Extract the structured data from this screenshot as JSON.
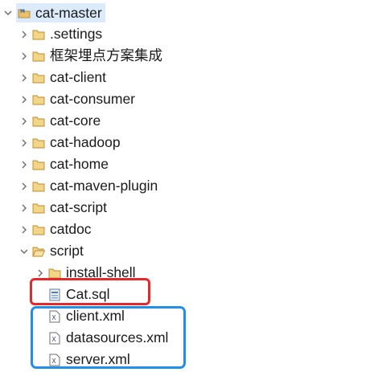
{
  "tree": {
    "root": {
      "label": "cat-master",
      "icon": "maven-project-icon",
      "expanded": true
    },
    "children": [
      {
        "label": ".settings",
        "icon": "folder-icon",
        "expanded": false
      },
      {
        "label": "框架埋点方案集成",
        "icon": "folder-icon",
        "expanded": false
      },
      {
        "label": "cat-client",
        "icon": "folder-icon",
        "expanded": false
      },
      {
        "label": "cat-consumer",
        "icon": "folder-icon",
        "expanded": false
      },
      {
        "label": "cat-core",
        "icon": "folder-icon",
        "expanded": false
      },
      {
        "label": "cat-hadoop",
        "icon": "folder-icon",
        "expanded": false
      },
      {
        "label": "cat-home",
        "icon": "folder-icon",
        "expanded": false
      },
      {
        "label": "cat-maven-plugin",
        "icon": "folder-icon",
        "expanded": false
      },
      {
        "label": "cat-script",
        "icon": "folder-icon",
        "expanded": false
      },
      {
        "label": "catdoc",
        "icon": "folder-icon",
        "expanded": false
      },
      {
        "label": "script",
        "icon": "folder-open-icon",
        "expanded": true
      }
    ],
    "script_children": [
      {
        "label": "install-shell",
        "icon": "folder-icon",
        "expanded": false
      },
      {
        "label": "Cat.sql",
        "icon": "sql-file-icon"
      },
      {
        "label": "client.xml",
        "icon": "xml-file-icon"
      },
      {
        "label": "datasources.xml",
        "icon": "xml-file-icon"
      },
      {
        "label": "server.xml",
        "icon": "xml-file-icon"
      }
    ]
  },
  "colors": {
    "selection": "#dcebfb",
    "folder": "#d9a441",
    "highlight_red": "#e8272b",
    "highlight_blue": "#1f8fe8"
  }
}
